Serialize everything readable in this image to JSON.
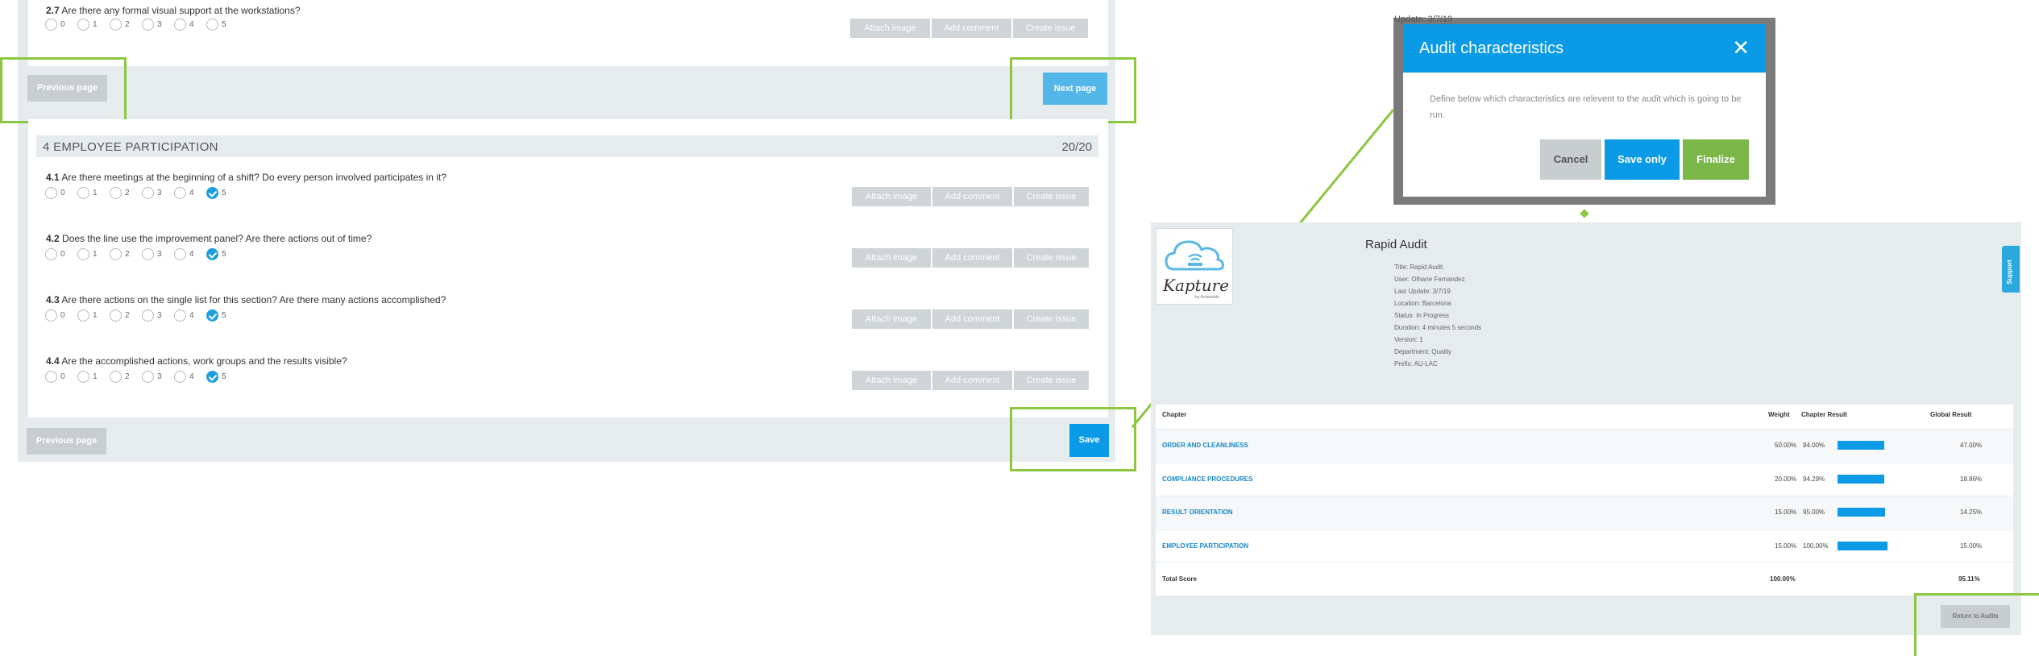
{
  "form": {
    "q27": {
      "num": "2.7",
      "text": "Are there any formal visual support at the workstations?"
    },
    "section": {
      "title": "4 EMPLOYEE PARTICIPATION",
      "score": "20/20"
    },
    "questions": [
      {
        "num": "4.1",
        "text": "Are there meetings at the beginning of a shift? Do every person involved participates in it?"
      },
      {
        "num": "4.2",
        "text": "Does the line use the improvement panel? Are there actions out of time?"
      },
      {
        "num": "4.3",
        "text": "Are there actions on the single list for this section? Are there many actions accomplished?"
      },
      {
        "num": "4.4",
        "text": "Are the accomplished actions, work groups and the results visible?"
      }
    ],
    "scale": [
      "0",
      "1",
      "2",
      "3",
      "4",
      "5"
    ],
    "buttons": {
      "attach": "Attach image",
      "comment": "Add comment",
      "issue": "Create issue",
      "previous": "Previous page",
      "next": "Next page",
      "save": "Save"
    }
  },
  "modal": {
    "bg_update": "Update: 3/7/19",
    "title": "Audit characteristics",
    "close_icon": "close-icon",
    "body": "Define below which characteristics are relevent to the audit which is going to be run.",
    "cancel": "Cancel",
    "save_only": "Save only",
    "finalize": "Finalize"
  },
  "result": {
    "brand": "Kapture",
    "brand_sub": "by Actionable",
    "title": "Rapid Audit",
    "meta": [
      "Title: Rapid Audit",
      "User: Olhane Fernandez",
      "Last Update: 3/7/19",
      "Location: Barcelona",
      "Status: In Progress",
      "Duration: 4 minutes 5 seconds",
      "Version: 1",
      "Department: Quality",
      "Prefix: AU-LAC"
    ],
    "support": "Support",
    "headers": {
      "chapter": "Chapter",
      "weight": "Weight",
      "chapter_result": "Chapter Result",
      "global": "Global Result"
    },
    "rows": [
      {
        "chapter": "ORDER AND CLEANLINESS",
        "weight": "50.00%",
        "result": "94.00%",
        "fill": 0.94,
        "global": "47.00%"
      },
      {
        "chapter": "COMPLIANCE PROCEDURES",
        "weight": "20.00%",
        "result": "94.29%",
        "fill": 0.9429,
        "global": "18.86%"
      },
      {
        "chapter": "RESULT ORIENTATION",
        "weight": "15.00%",
        "result": "95.00%",
        "fill": 0.95,
        "global": "14.25%"
      },
      {
        "chapter": "EMPLOYEE PARTICIPATION",
        "weight": "15.00%",
        "result": "100.00%",
        "fill": 1.0,
        "global": "15.00%"
      }
    ],
    "total": {
      "label": "Total Score",
      "weight": "100.00%",
      "global": "95.11%"
    },
    "return_button": "Return to Audits"
  },
  "colors": {
    "accent": "#0a9ae6",
    "highlight": "#8dc63f",
    "finalize": "#7ab648"
  }
}
